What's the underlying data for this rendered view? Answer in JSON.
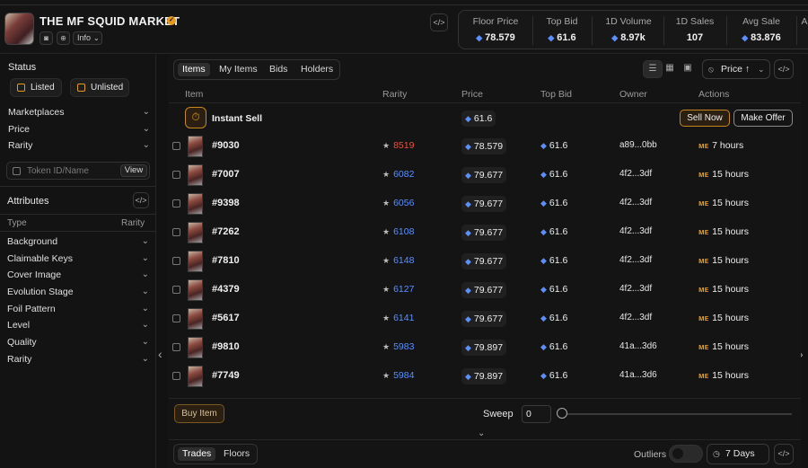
{
  "collection": {
    "title": "THE MF SQUID MARKET",
    "info_label": "Info",
    "verified_icon": "verified-badge-icon",
    "social_icons": [
      "discord-icon",
      "globe-icon"
    ]
  },
  "stats": [
    {
      "label": "Floor Price",
      "value": "78.579",
      "icon": "drop-icon"
    },
    {
      "label": "Top Bid",
      "value": "61.6",
      "icon": "drop-icon"
    },
    {
      "label": "1D Volume",
      "value": "8.97k",
      "icon": "drop-icon"
    },
    {
      "label": "1D Sales",
      "value": "107",
      "icon": ""
    },
    {
      "label": "Avg Sale",
      "value": "83.876",
      "icon": "drop-icon"
    },
    {
      "label": "A",
      "value": "",
      "icon": ""
    }
  ],
  "sidebar": {
    "status_title": "Status",
    "listed_label": "Listed",
    "unlisted_label": "Unlisted",
    "filters": [
      "Marketplaces",
      "Price",
      "Rarity"
    ],
    "token_placeholder": "Token ID/Name",
    "view_label": "View",
    "attributes_title": "Attributes",
    "type_col": "Type",
    "rarity_col": "Rarity",
    "attributes": [
      "Background",
      "Claimable Keys",
      "Cover Image",
      "Evolution Stage",
      "Foil Pattern",
      "Level",
      "Quality",
      "Rarity"
    ]
  },
  "main": {
    "tabs": [
      "Items",
      "My Items",
      "Bids",
      "Holders"
    ],
    "active_tab": "Items",
    "sort_label": "Price",
    "columns": [
      "Item",
      "Rarity",
      "Price",
      "Top Bid",
      "Owner",
      "Actions"
    ],
    "instant_sell": {
      "label": "Instant Sell",
      "price": "61.6",
      "sell_now": "Sell Now",
      "make_offer": "Make Offer"
    },
    "rows": [
      {
        "id": "#9030",
        "rarity": "8519",
        "rarity_color": "#e5533d",
        "price": "78.579",
        "top_bid": "61.6",
        "owner": "a89...0bb",
        "listed": "7 hours"
      },
      {
        "id": "#7007",
        "rarity": "6082",
        "rarity_color": "#5b8fff",
        "price": "79.677",
        "top_bid": "61.6",
        "owner": "4f2...3df",
        "listed": "15 hours"
      },
      {
        "id": "#9398",
        "rarity": "6056",
        "rarity_color": "#5b8fff",
        "price": "79.677",
        "top_bid": "61.6",
        "owner": "4f2...3df",
        "listed": "15 hours"
      },
      {
        "id": "#7262",
        "rarity": "6108",
        "rarity_color": "#5b8fff",
        "price": "79.677",
        "top_bid": "61.6",
        "owner": "4f2...3df",
        "listed": "15 hours"
      },
      {
        "id": "#7810",
        "rarity": "6148",
        "rarity_color": "#5b8fff",
        "price": "79.677",
        "top_bid": "61.6",
        "owner": "4f2...3df",
        "listed": "15 hours"
      },
      {
        "id": "#4379",
        "rarity": "6127",
        "rarity_color": "#5b8fff",
        "price": "79.677",
        "top_bid": "61.6",
        "owner": "4f2...3df",
        "listed": "15 hours"
      },
      {
        "id": "#5617",
        "rarity": "6141",
        "rarity_color": "#5b8fff",
        "price": "79.677",
        "top_bid": "61.6",
        "owner": "4f2...3df",
        "listed": "15 hours"
      },
      {
        "id": "#9810",
        "rarity": "5983",
        "rarity_color": "#5b8fff",
        "price": "79.897",
        "top_bid": "61.6",
        "owner": "41a...3d6",
        "listed": "15 hours"
      },
      {
        "id": "#7749",
        "rarity": "5984",
        "rarity_color": "#5b8fff",
        "price": "79.897",
        "top_bid": "61.6",
        "owner": "41a...3d6",
        "listed": "15 hours"
      }
    ],
    "buy_item_label": "Buy Item",
    "sweep_label": "Sweep",
    "sweep_value": "0"
  },
  "bottom": {
    "tabs": [
      "Trades",
      "Floors"
    ],
    "active_tab": "Trades",
    "outliers_label": "Outliers",
    "days_label": "7 Days"
  },
  "colors": {
    "accent": "#e39a20",
    "sol_blue": "#5b8fff",
    "background": "#121212"
  }
}
